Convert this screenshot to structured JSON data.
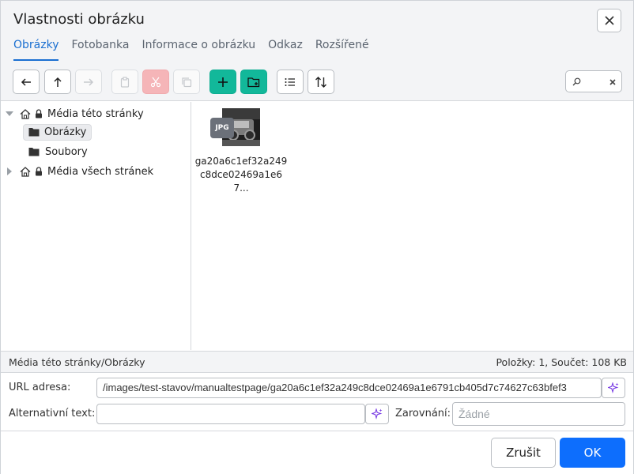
{
  "dialog": {
    "title": "Vlastnosti obrázku",
    "close_icon": "close-icon"
  },
  "tabs": [
    {
      "label": "Obrázky",
      "active": true
    },
    {
      "label": "Fotobanka",
      "active": false
    },
    {
      "label": "Informace o obrázku",
      "active": false
    },
    {
      "label": "Odkaz",
      "active": false
    },
    {
      "label": "Rozšířené",
      "active": false
    }
  ],
  "toolbar": {
    "buttons": [
      {
        "icon": "arrow-left-icon",
        "enabled": true
      },
      {
        "icon": "arrow-up-icon",
        "enabled": true
      },
      {
        "icon": "arrow-right-icon",
        "enabled": false
      },
      {
        "icon": "paste-icon",
        "enabled": false
      },
      {
        "icon": "cut-icon",
        "enabled": false
      },
      {
        "icon": "copy-icon",
        "enabled": false
      },
      {
        "icon": "plus-icon",
        "enabled": true
      },
      {
        "icon": "new-folder-icon",
        "enabled": true
      },
      {
        "icon": "list-view-icon",
        "enabled": true
      },
      {
        "icon": "sort-icon",
        "enabled": true
      }
    ],
    "search_value": ""
  },
  "tree": {
    "items": [
      {
        "label": "Média této stránky",
        "icon": "home-icon",
        "locked": true,
        "expanded": true
      },
      {
        "label": "Obrázky",
        "icon": "folder-icon",
        "selected": true
      },
      {
        "label": "Soubory",
        "icon": "folder-icon",
        "selected": false
      },
      {
        "label": "Média všech stránek",
        "icon": "home-icon",
        "locked": true,
        "expanded": false
      }
    ]
  },
  "files": [
    {
      "name": "ga20a6c1ef32a249c8dce02469a1e67...",
      "type_badge": "JPG"
    }
  ],
  "status": {
    "path": "Média této stránky/Obrázky",
    "summary": "Položky: 1, Součet: 108 KB"
  },
  "form": {
    "url_label": "URL adresa:",
    "url_value": "/images/test-stavov/manualtestpage/ga20a6c1ef32a249c8dce02469a1e6791cb405d7c74627c63bfef3",
    "alt_label": "Alternativní text:",
    "alt_value": "",
    "align_label": "Zarovnání:",
    "align_value": "Žádné"
  },
  "footer": {
    "cancel_label": "Zrušit",
    "ok_label": "OK"
  },
  "colors": {
    "accent": "#0d6efd",
    "tab_active": "#1a6fd1",
    "green": "#12b89a",
    "disabled_red": "#f5b5b8"
  }
}
